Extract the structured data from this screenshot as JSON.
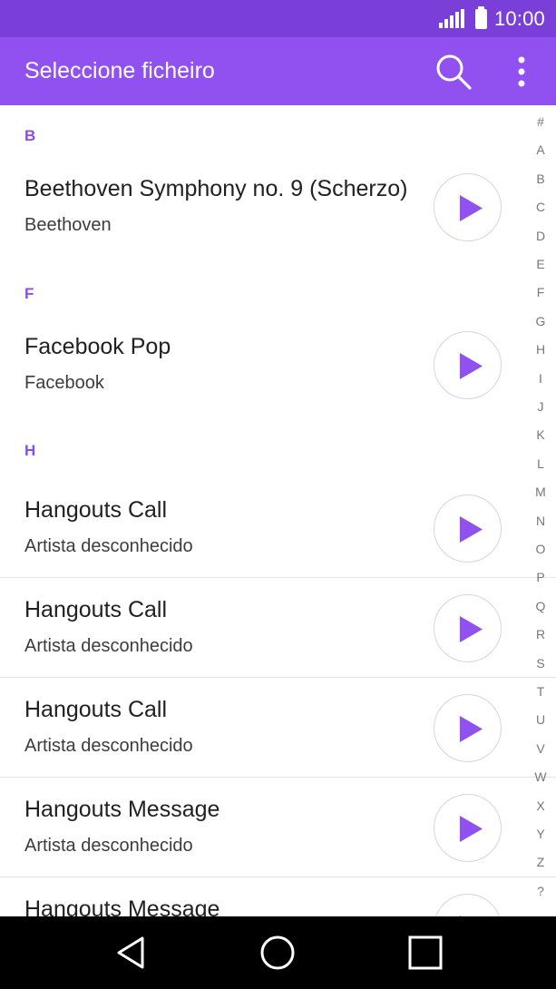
{
  "status_bar": {
    "time": "10:00"
  },
  "app_bar": {
    "title": "Seleccione ficheiro",
    "search_icon": "search-icon",
    "more_icon": "more-vert-icon"
  },
  "accent_color": "#9150f0",
  "sections": {
    "b": "B",
    "f": "F",
    "h": "H"
  },
  "rows": [
    {
      "title": "Beethoven Symphony no. 9 (Scherzo)",
      "subtitle": "Beethoven"
    },
    {
      "title": "Facebook Pop",
      "subtitle": "Facebook"
    },
    {
      "title": "Hangouts Call",
      "subtitle": "Artista desconhecido"
    },
    {
      "title": "Hangouts Call",
      "subtitle": "Artista desconhecido"
    },
    {
      "title": "Hangouts Call",
      "subtitle": "Artista desconhecido"
    },
    {
      "title": "Hangouts Message",
      "subtitle": "Artista desconhecido"
    },
    {
      "title": "Hangouts Message",
      "subtitle": ""
    }
  ],
  "alpha_index": [
    "#",
    "A",
    "B",
    "C",
    "D",
    "E",
    "F",
    "G",
    "H",
    "I",
    "J",
    "K",
    "L",
    "M",
    "N",
    "O",
    "P",
    "Q",
    "R",
    "S",
    "T",
    "U",
    "V",
    "W",
    "X",
    "Y",
    "Z",
    "?"
  ],
  "nav_bar": {
    "back_icon": "back-triangle-icon",
    "home_icon": "home-circle-icon",
    "recents_icon": "recents-square-icon"
  }
}
